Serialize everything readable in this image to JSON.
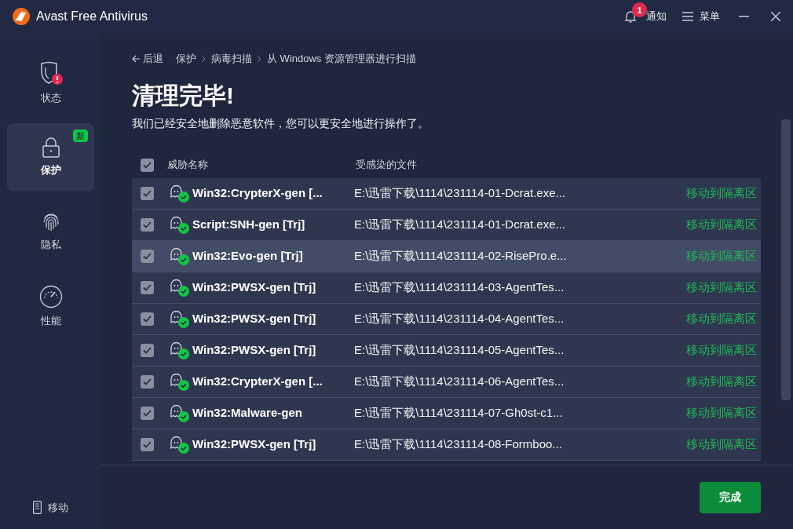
{
  "window": {
    "title": "Avast Free Antivirus"
  },
  "titlebar": {
    "notifications": {
      "label": "通知",
      "badge": "1"
    },
    "menu": {
      "label": "菜单"
    }
  },
  "sidebar": {
    "items": [
      {
        "kind": "status",
        "label": "状态",
        "selected": false,
        "alert": true
      },
      {
        "kind": "protect",
        "label": "保护",
        "selected": true,
        "badge": "新"
      },
      {
        "kind": "privacy",
        "label": "隐私",
        "selected": false
      },
      {
        "kind": "performance",
        "label": "性能",
        "selected": false
      }
    ],
    "mobile": {
      "label": "移动"
    }
  },
  "breadcrumb": {
    "back": "后退",
    "items": [
      "保护",
      "病毒扫描",
      "从 Windows 资源管理器进行扫描"
    ]
  },
  "heading": "清理完毕!",
  "subtitle": "我们已经安全地删除恶意软件，您可以更安全地进行操作了。",
  "table": {
    "all_checked": true,
    "columns": [
      "威胁名称",
      "受感染的文件"
    ],
    "rows": [
      {
        "checked": true,
        "highlighted": false,
        "threat": "Win32:CrypterX-gen [...",
        "file": "E:\\迅雷下载\\1114\\231114-01-Dcrat.exe...",
        "action": "移动到隔离区"
      },
      {
        "checked": true,
        "highlighted": false,
        "threat": "Script:SNH-gen [Trj]",
        "file": "E:\\迅雷下载\\1114\\231114-01-Dcrat.exe...",
        "action": "移动到隔离区"
      },
      {
        "checked": true,
        "highlighted": true,
        "threat": "Win32:Evo-gen [Trj]",
        "file": "E:\\迅雷下载\\1114\\231114-02-RisePro.e...",
        "action": "移动到隔离区"
      },
      {
        "checked": true,
        "highlighted": false,
        "threat": "Win32:PWSX-gen [Trj]",
        "file": "E:\\迅雷下载\\1114\\231114-03-AgentTes...",
        "action": "移动到隔离区"
      },
      {
        "checked": true,
        "highlighted": false,
        "threat": "Win32:PWSX-gen [Trj]",
        "file": "E:\\迅雷下载\\1114\\231114-04-AgentTes...",
        "action": "移动到隔离区"
      },
      {
        "checked": true,
        "highlighted": false,
        "threat": "Win32:PWSX-gen [Trj]",
        "file": "E:\\迅雷下载\\1114\\231114-05-AgentTes...",
        "action": "移动到隔离区"
      },
      {
        "checked": true,
        "highlighted": false,
        "threat": "Win32:CrypterX-gen [...",
        "file": "E:\\迅雷下载\\1114\\231114-06-AgentTes...",
        "action": "移动到隔离区"
      },
      {
        "checked": true,
        "highlighted": false,
        "threat": "Win32:Malware-gen",
        "file": "E:\\迅雷下载\\1114\\231114-07-Gh0st-c1...",
        "action": "移动到隔离区"
      },
      {
        "checked": true,
        "highlighted": false,
        "threat": "Win32:PWSX-gen [Trj]",
        "file": "E:\\迅雷下载\\1114\\231114-08-Formboo...",
        "action": "移动到隔离区"
      }
    ]
  },
  "done_button": "完成"
}
